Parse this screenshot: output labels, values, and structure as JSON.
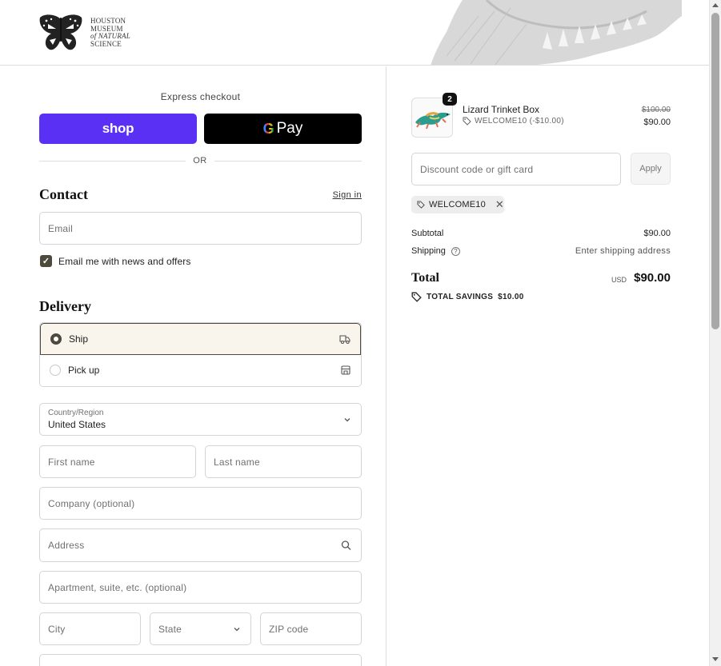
{
  "brand": {
    "logo_lines": [
      "HOUSTON",
      "MUSEUM",
      "of NATURAL",
      "SCIENCE"
    ]
  },
  "express": {
    "label": "Express checkout",
    "shop_pay": "shop",
    "gpay_g": "G",
    "gpay_text": "Pay",
    "or": "OR"
  },
  "contact": {
    "title": "Contact",
    "sign_in": "Sign in",
    "email_placeholder": "Email",
    "newsletter_label": "Email me with news and offers",
    "newsletter_checked": true
  },
  "delivery": {
    "title": "Delivery",
    "options": [
      {
        "label": "Ship",
        "selected": true,
        "icon": "truck-icon"
      },
      {
        "label": "Pick up",
        "selected": false,
        "icon": "store-icon"
      }
    ],
    "country_label": "Country/Region",
    "country_value": "United States",
    "first_name": "First name",
    "last_name": "Last name",
    "company": "Company (optional)",
    "address": "Address",
    "apartment": "Apartment, suite, etc. (optional)",
    "city": "City",
    "state": "State",
    "zip": "ZIP code"
  },
  "order": {
    "item": {
      "name": "Lizard Trinket Box",
      "quantity": "2",
      "discount": "WELCOME10 (-$10.00)",
      "price_original": "$100.00",
      "price_final": "$90.00"
    },
    "discount_placeholder": "Discount code or gift card",
    "apply": "Apply",
    "applied_code": "WELCOME10",
    "subtotal_label": "Subtotal",
    "subtotal_value": "$90.00",
    "shipping_label": "Shipping",
    "shipping_value": "Enter shipping address",
    "total_label": "Total",
    "currency": "USD",
    "total_value": "$90.00",
    "savings_label": "TOTAL SAVINGS",
    "savings_value": "$10.00"
  },
  "colors": {
    "accent": "#4b4a3c",
    "shop_pay": "#5a31f4",
    "selected_bg": "#f9f4ec"
  }
}
